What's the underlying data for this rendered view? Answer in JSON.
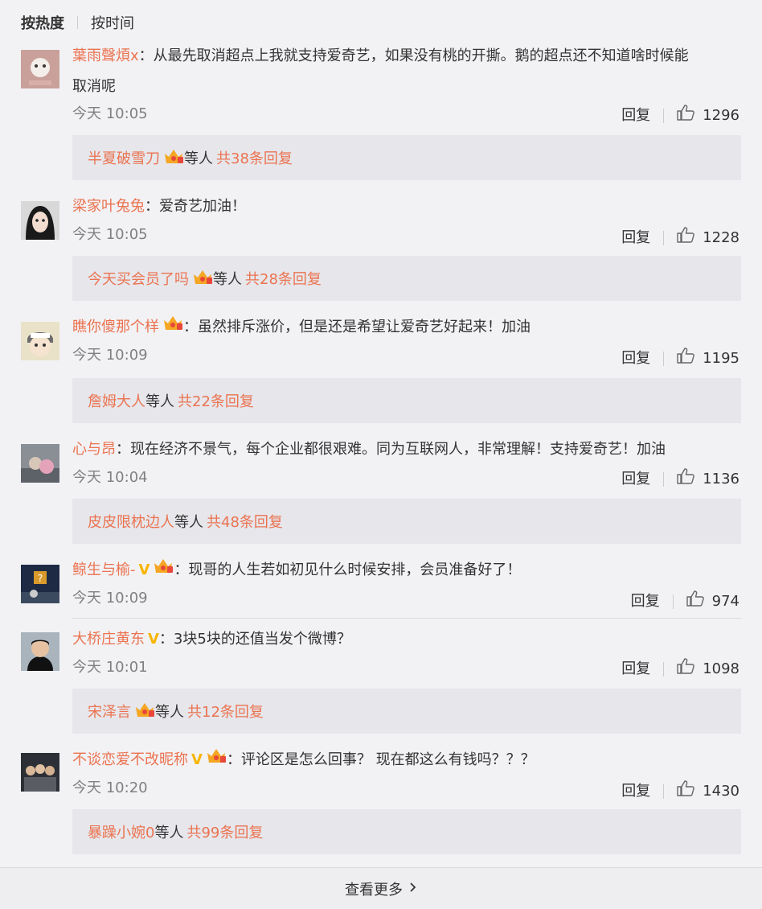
{
  "sort": {
    "hot": "按热度",
    "time": "按时间"
  },
  "comments": [
    {
      "user": "葉雨聲煩x",
      "text": "：从最先取消超点上我就支持爱奇艺，如果没有桃的开撕。鹅的超点还不知道啥时候能",
      "text2": "取消呢",
      "time": "今天 10:05",
      "reply_label": "回复",
      "likes": "1296",
      "thread": {
        "user": "半夏破雪刀",
        "mid": " 等人 ",
        "count": "共38条回复"
      }
    },
    {
      "user": "梁家叶兔兔",
      "text": "：爱奇艺加油！",
      "time": "今天 10:05",
      "reply_label": "回复",
      "likes": "1228",
      "thread": {
        "user": "今天买会员了吗",
        "mid": " 等人 ",
        "count": "共28条回复"
      }
    },
    {
      "user": "瞧你傻那个样",
      "text": "：虽然排斥涨价，但是还是希望让爱奇艺好起来！加油",
      "time": "今天 10:09",
      "reply_label": "回复",
      "likes": "1195",
      "thread": {
        "user": "詹姆大人",
        "mid": " 等人 ",
        "count": "共22条回复"
      }
    },
    {
      "user": "心与昂",
      "text": "：现在经济不景气，每个企业都很艰难。同为互联网人，非常理解！支持爱奇艺！加油",
      "time": "今天 10:04",
      "reply_label": "回复",
      "likes": "1136",
      "thread": {
        "user": "皮皮限枕边人",
        "mid": " 等人 ",
        "count": "共48条回复"
      }
    },
    {
      "user": "鲸生与榆-",
      "text": "：现哥的人生若如初见什么时候安排，会员准备好了！",
      "time": "今天 10:09",
      "reply_label": "回复",
      "likes": "974"
    },
    {
      "user": "大桥庄黄东",
      "text": "：3块5块的还值当发个微博？",
      "time": "今天 10:01",
      "reply_label": "回复",
      "likes": "1098",
      "thread": {
        "user": "宋泽言",
        "mid": " 等人 ",
        "count": "共12条回复"
      }
    },
    {
      "user": "不谈恋爱不改昵称",
      "text": "：评论区是怎么回事？ 现在都这么有钱吗？？？",
      "time": "今天 10:20",
      "reply_label": "回复",
      "likes": "1430",
      "thread": {
        "user": "暴躁小婉0",
        "mid": " 等人 ",
        "count": "共99条回复"
      }
    }
  ],
  "more": "查看更多",
  "colors": {
    "username": "#eb7350",
    "vip": "#f7b500",
    "crown": "#f5a623"
  },
  "vip_mark": "V"
}
